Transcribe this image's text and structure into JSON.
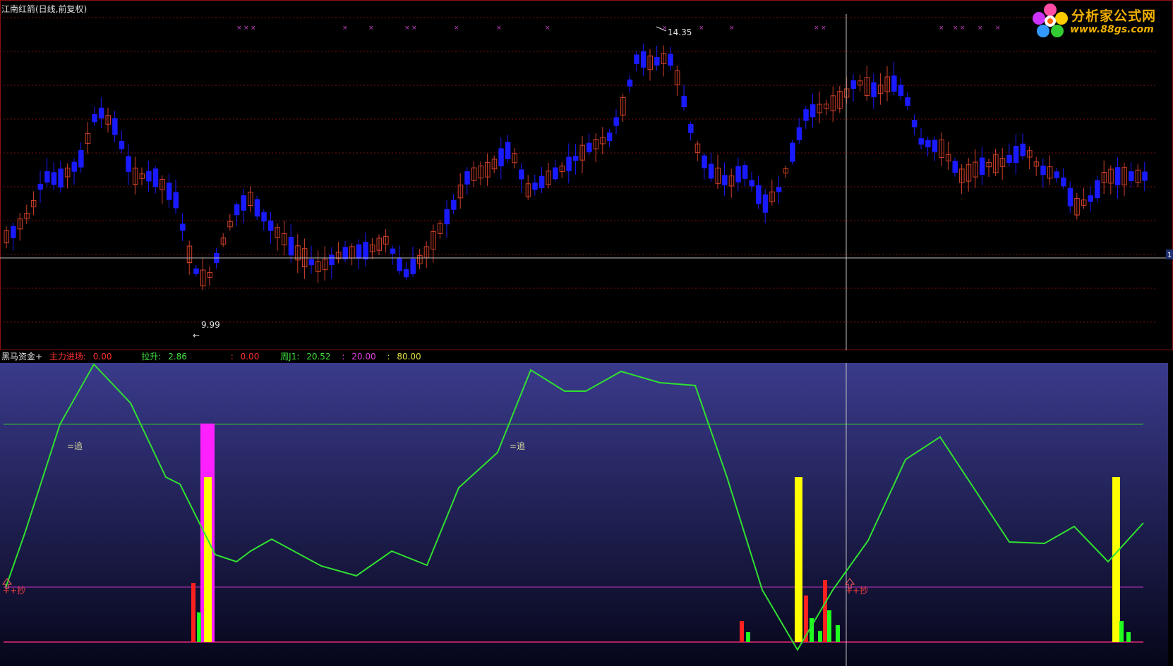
{
  "window": {
    "title": "江南红箭(日线,前复权)"
  },
  "watermark": {
    "name": "分析家公式网",
    "url": "www.88gs.com"
  },
  "price_chart": {
    "high_label": "14.35",
    "low_label": "9.99",
    "right_edge_label": "1",
    "colors": {
      "up": "#d0402a",
      "down": "#1a1aff",
      "grid": "#7a1010",
      "cursor": "#c0c0c0",
      "marker": "#c040c0"
    }
  },
  "indicator": {
    "name": "黑马资金+",
    "items": [
      {
        "label": "主力进场:",
        "value": "0.00",
        "color": "#ff3030"
      },
      {
        "label": "拉升:",
        "value": "2.86",
        "color": "#40e040"
      },
      {
        "label": ":",
        "value": "0.00",
        "color": "#ff3030"
      },
      {
        "label": "周J1:",
        "value": "20.52",
        "color": "#40e040"
      },
      {
        "label": ":",
        "value": "20.00",
        "color": "#e040e0"
      },
      {
        "label": ":",
        "value": "80.00",
        "color": "#e0e040"
      }
    ],
    "annotations": {
      "chase": "=追",
      "buy": "++抄"
    },
    "colors": {
      "line": "#30e030",
      "upper": "#30c030",
      "lower": "#c030c0",
      "yellow": "#ffff00",
      "magenta": "#ff20ff",
      "red": "#ff2020",
      "green": "#20ff20"
    }
  }
}
